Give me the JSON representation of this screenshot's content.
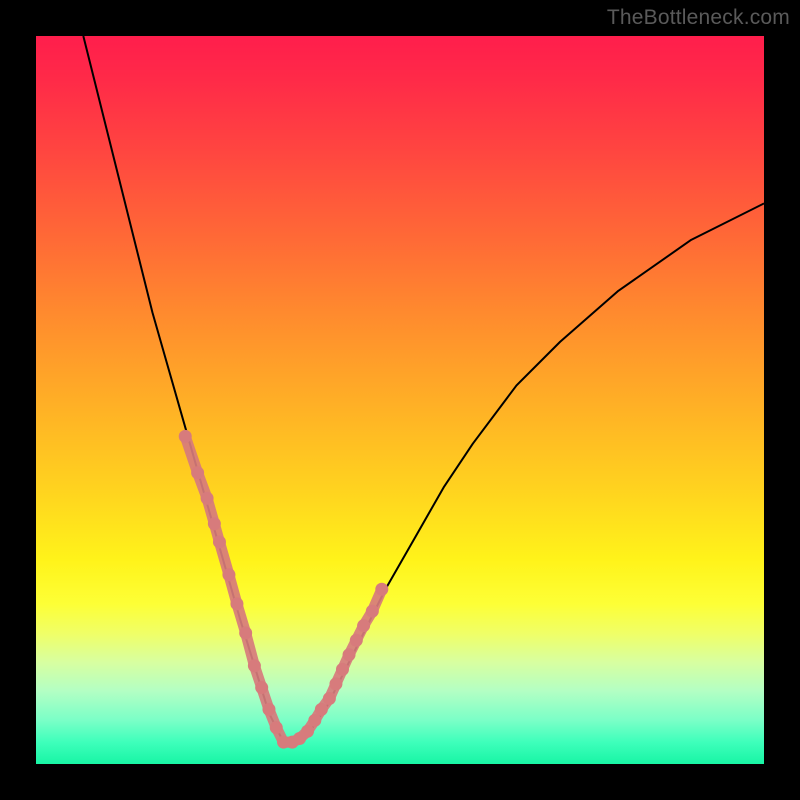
{
  "watermark": "TheBottleneck.com",
  "colors": {
    "curve_stroke": "#000000",
    "highlight_stroke": "#d77b7c",
    "gradient_top": "#ff1e4c",
    "gradient_bottom": "#18f5a5",
    "frame": "#000000"
  },
  "chart_data": {
    "type": "line",
    "title": "",
    "xlabel": "",
    "ylabel": "",
    "xlim": [
      0,
      100
    ],
    "ylim": [
      0,
      100
    ],
    "grid": false,
    "legend": false,
    "notes": "No axis ticks or labels are rendered. Y-axis is inverted visually (0 at bottom = green, 100 at top = red). The curve is a V-shaped bottleneck curve with minimum near x≈34. A pink highlight overlays the lower portion of the curve with dot markers.",
    "series": [
      {
        "name": "bottleneck-curve",
        "color": "#000000",
        "x": [
          6.5,
          8,
          10,
          12,
          14,
          16,
          18,
          20,
          22,
          24,
          26,
          28,
          30,
          32,
          34,
          36,
          38,
          40,
          42,
          44,
          46,
          48,
          52,
          56,
          60,
          66,
          72,
          80,
          90,
          100
        ],
        "y": [
          100,
          94,
          86,
          78,
          70,
          62,
          55,
          48,
          41,
          34,
          27,
          20,
          13.5,
          7,
          3,
          3,
          5,
          8,
          12,
          16,
          20,
          24,
          31,
          38,
          44,
          52,
          58,
          65,
          72,
          77
        ]
      },
      {
        "name": "highlight-dots",
        "color": "#d77b7c",
        "marker": "circle",
        "x": [
          20.5,
          22.2,
          23.5,
          24.5,
          25.2,
          26.5,
          27.6,
          28.8,
          30.0,
          31.0,
          32.0,
          33.0,
          34.0,
          35.2,
          36.2,
          37.3,
          38.3,
          39.2,
          40.3,
          41.2,
          42.1,
          43.0,
          44.0,
          45.0,
          46.2,
          47.5
        ],
        "y": [
          45,
          40,
          36.5,
          33,
          30.5,
          26,
          22,
          18,
          13.5,
          10.5,
          7.5,
          5,
          3,
          3,
          3.5,
          4.5,
          6,
          7.5,
          9,
          11,
          13,
          15,
          17,
          19,
          21,
          24
        ]
      }
    ]
  }
}
